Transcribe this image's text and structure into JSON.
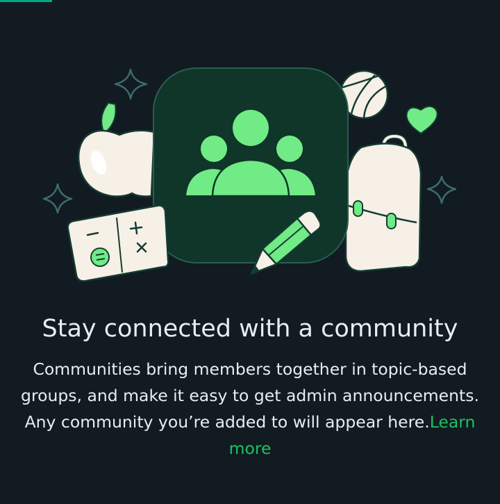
{
  "tab_indicator_color": "#00a884",
  "empty_state": {
    "title": "Stay connected with a community",
    "description": "Communities bring members together in topic-based groups, and make it easy to get admin announcements. Any community you’re added to will appear here.",
    "learn_more_label": "Learn more"
  },
  "illustration": {
    "center_icon": "community-people-icon",
    "decorations": [
      "apple-icon",
      "volleyball-icon",
      "heart-icon",
      "backpack-icon",
      "calculator-icon",
      "pencil-icon",
      "sparkle-icon"
    ]
  },
  "colors": {
    "background": "#111b21",
    "accent_green": "#21c063",
    "icon_green": "#71eb85",
    "text": "#e9edef"
  }
}
